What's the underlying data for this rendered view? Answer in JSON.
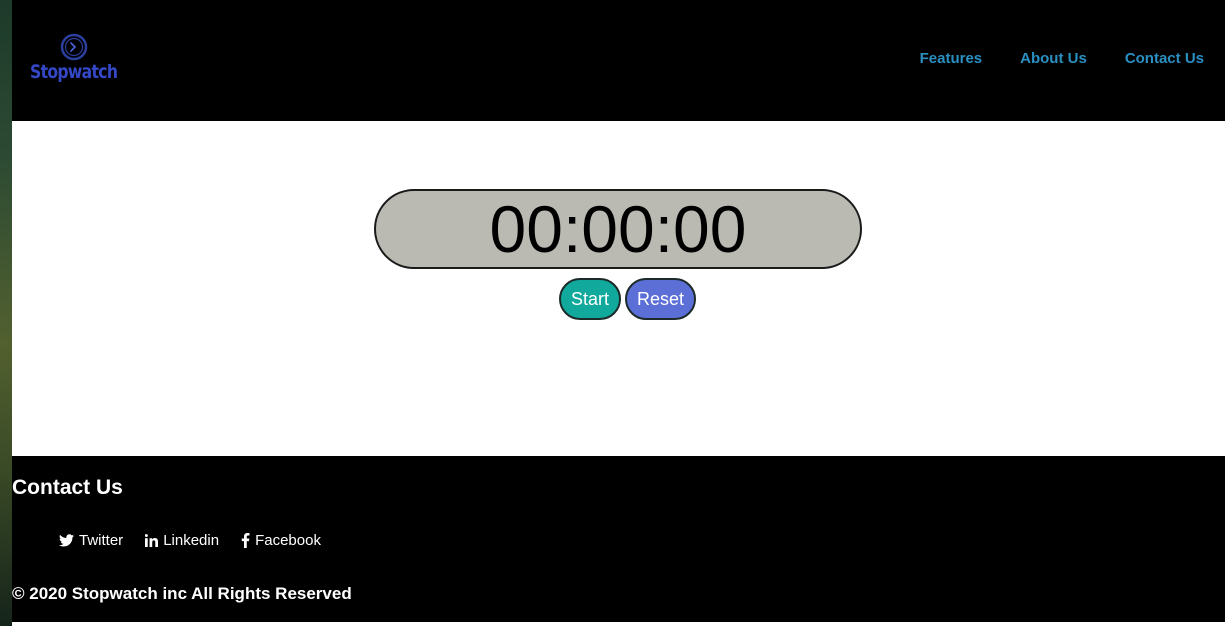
{
  "header": {
    "logo_text": "Stopwatch",
    "logo_icon": "stopwatch-icon",
    "nav": [
      {
        "label": "Features"
      },
      {
        "label": "About Us"
      },
      {
        "label": "Contact Us"
      }
    ],
    "colors": {
      "logo": "#3448c8",
      "nav": "#2a8fc1"
    }
  },
  "stopwatch": {
    "time": "00:00:00",
    "start_label": "Start",
    "reset_label": "Reset",
    "colors": {
      "display_bg": "#babab2",
      "start": "#10a99c",
      "reset": "#5b6fd6"
    }
  },
  "footer": {
    "title": "Contact Us",
    "social": [
      {
        "label": "Twitter",
        "icon": "twitter-icon"
      },
      {
        "label": "Linkedin",
        "icon": "linkedin-icon"
      },
      {
        "label": "Facebook",
        "icon": "facebook-icon"
      }
    ],
    "copyright": "© 2020 Stopwatch inc All Rights Reserved"
  }
}
